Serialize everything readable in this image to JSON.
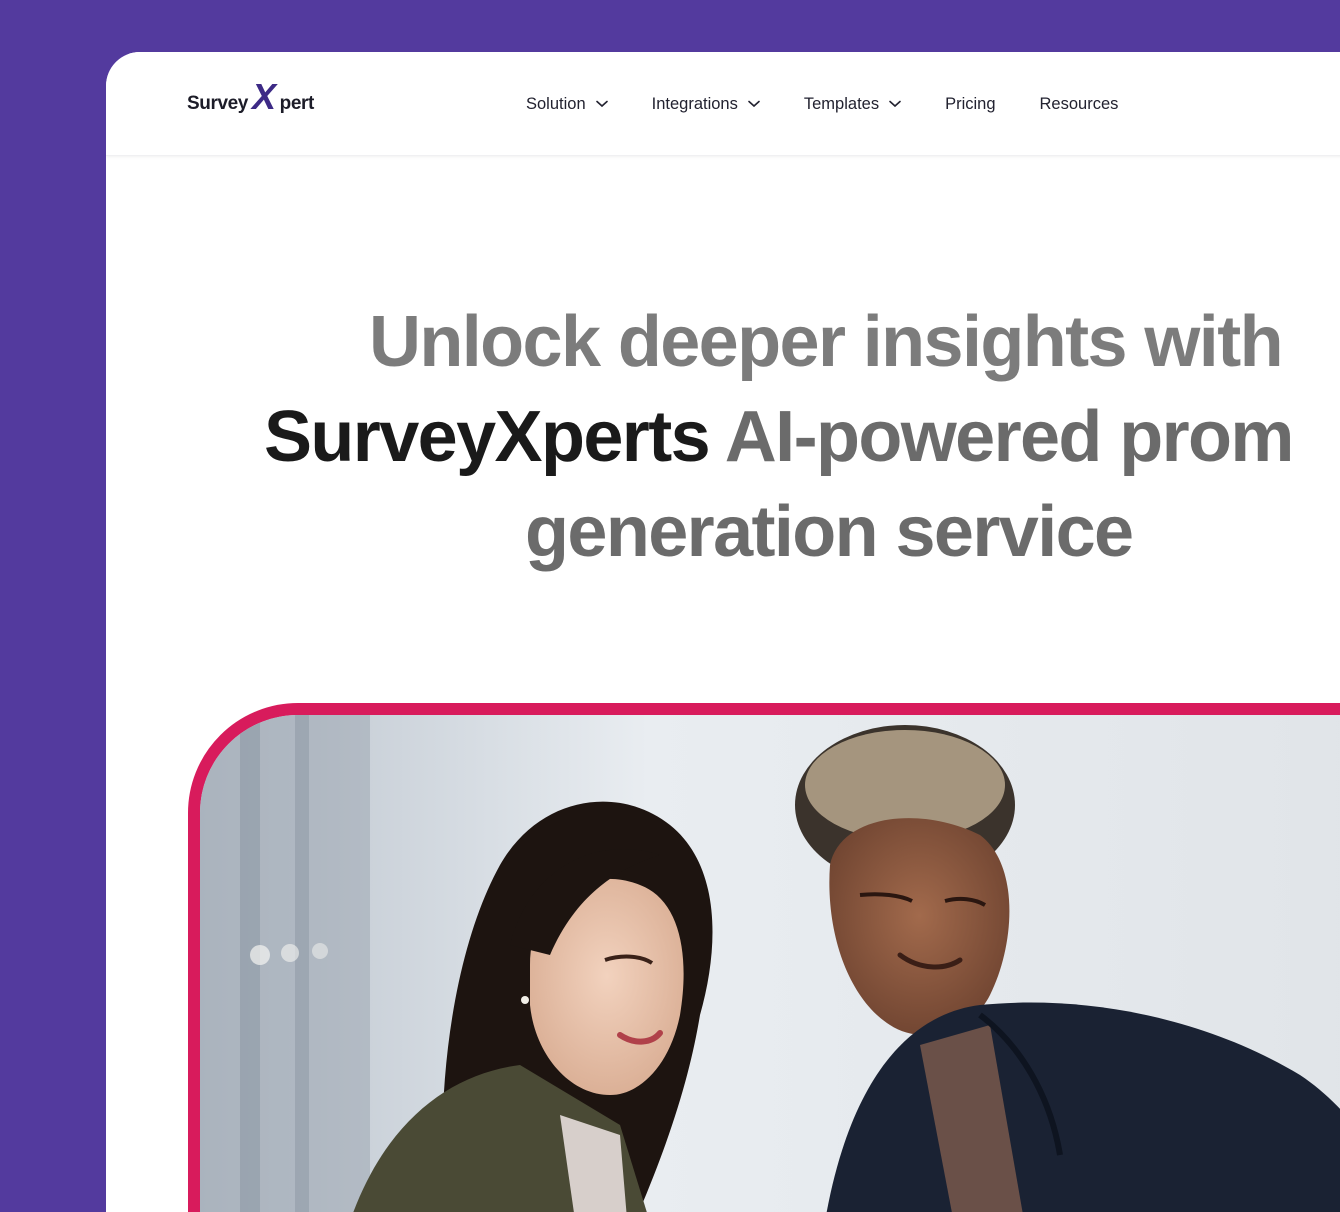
{
  "brand": {
    "logo_prefix": "Survey",
    "logo_x": "X",
    "logo_suffix": "pert",
    "accent": "#3d2a86",
    "background": "#533a9e",
    "frame_color": "#d81b5c"
  },
  "nav": {
    "items": [
      {
        "label": "Solution",
        "has_dropdown": true
      },
      {
        "label": "Integrations",
        "has_dropdown": true
      },
      {
        "label": "Templates",
        "has_dropdown": true
      },
      {
        "label": "Pricing",
        "has_dropdown": false
      },
      {
        "label": "Resources",
        "has_dropdown": false
      }
    ]
  },
  "hero": {
    "line1": "Unlock deeper insights with",
    "line2_strong": "SurveyXperts",
    "line2_rest": "AI-powered prom",
    "line3": "generation service"
  },
  "image": {
    "description_icon": "photo-two-people-looking-down"
  }
}
